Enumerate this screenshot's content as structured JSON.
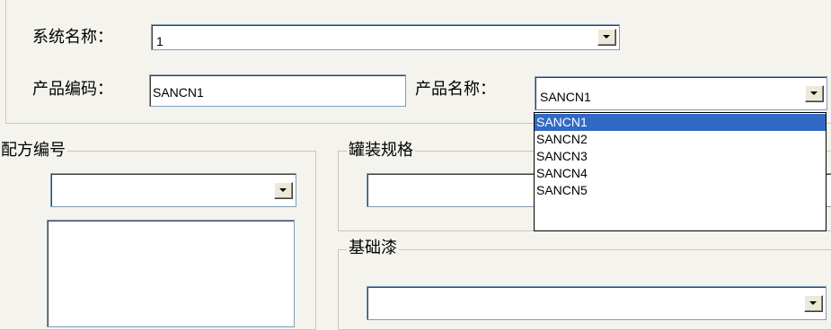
{
  "system": {
    "label": "系统名称：",
    "value": "1"
  },
  "product_code": {
    "label": "产品编码：",
    "value": "SANCN1"
  },
  "product_name": {
    "label": "产品名称：",
    "value": "SANCN1",
    "options": [
      "SANCN1",
      "SANCN2",
      "SANCN3",
      "SANCN4",
      "SANCN5"
    ],
    "selected_index": 0
  },
  "formula_group": {
    "title": "配方编号",
    "value": ""
  },
  "can_spec_group": {
    "title": "罐装规格",
    "value": ""
  },
  "base_paint_group": {
    "title": "基础漆",
    "value": ""
  },
  "colors": {
    "selection": "#316ac5",
    "background": "#f4f3ee",
    "border": "#c9c7ba"
  }
}
